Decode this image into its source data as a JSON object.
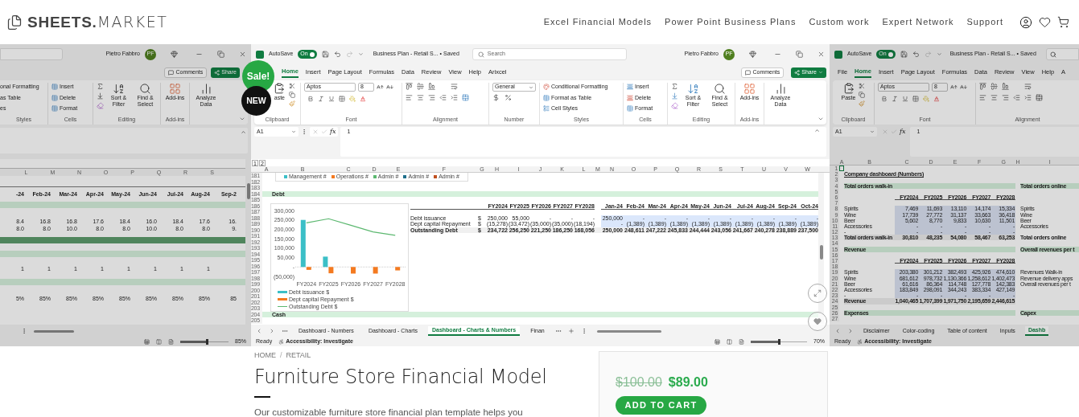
{
  "header": {
    "logo_bold": "SHEETS.",
    "logo_light": "MARKET",
    "nav": [
      "Excel Financial Models",
      "Power Point Business Plans",
      "Custom work",
      "Expert Network",
      "Support"
    ]
  },
  "gallery": {
    "badges": {
      "sale": "Sale!",
      "new": "NEW"
    },
    "left_slide": {
      "user": "Pietro Fabbro",
      "initials": "PF",
      "comments": "Comments",
      "share": "Share",
      "styles": [
        "onal Formatting",
        "as Table",
        "es"
      ],
      "cells": [
        "Insert",
        "Delete",
        "Format"
      ],
      "sort": "Sort & Filter",
      "find": "Find & Select",
      "addins": "Add-ins",
      "analyze": "Analyze Data",
      "groups": [
        "Styles",
        "Cells",
        "Editing",
        "Add-ins"
      ],
      "columns": [
        "L",
        "M",
        "N",
        "O",
        "P",
        "Q",
        "R",
        "S"
      ],
      "months": [
        "-24",
        "Feb-24",
        "Mar-24",
        "Apr-24",
        "May-24",
        "Jun-24",
        "Jul-24",
        "Aug-24",
        "Sep-2"
      ],
      "value_rows": [
        [
          "8.4",
          "16.8",
          "16.8",
          "17.6",
          "18.4",
          "16.0",
          "18.4",
          "17.6",
          "16."
        ],
        [
          "8.0",
          "8.0",
          "10.0",
          "8.0",
          "8.0",
          "10.0",
          "8.0",
          "8.0",
          "9."
        ]
      ],
      "ones": [
        "1",
        "1",
        "1",
        "1",
        "1",
        "1",
        "1",
        "1"
      ],
      "percents": [
        "5%",
        "85%",
        "85%",
        "85%",
        "85%",
        "85%",
        "85%",
        "85%",
        "85"
      ],
      "zoom": "85%",
      "zoom_slider": {
        "level": 0.55
      }
    },
    "main_slide": {
      "autosave": "AutoSave",
      "autosave_on": true,
      "toggle": "On",
      "file": "Business Plan - Retail S... • Saved",
      "search": "Search",
      "user": "Pietro Fabbro",
      "initials": "PF",
      "ribbon_tabs": [
        {
          "label": "Home",
          "selected": true
        },
        {
          "label": "Insert",
          "selected": false
        },
        {
          "label": "Page Layout",
          "selected": false
        },
        {
          "label": "Formulas",
          "selected": false
        },
        {
          "label": "Data",
          "selected": false
        },
        {
          "label": "Review",
          "selected": false
        },
        {
          "label": "View",
          "selected": false
        },
        {
          "label": "Help",
          "selected": false
        },
        {
          "label": "Arixcel",
          "selected": false
        }
      ],
      "comments": "Comments",
      "share": "Share",
      "paste": "aste",
      "font": "Aptos",
      "size": "8",
      "number_format": "General",
      "styles": [
        "Conditional Formatting",
        "Format as Table",
        "Cell Styles"
      ],
      "cells": [
        "Insert",
        "Delete",
        "Format"
      ],
      "sort": "Sort & Filter",
      "find": "Find & Select",
      "addins": "Add-ins",
      "analyze": "Analyze Data",
      "groups": [
        "Clipboard",
        "Font",
        "Alignment",
        "Number",
        "Styles",
        "Cells",
        "Editing",
        "Add-ins"
      ],
      "formula": {
        "cell": "A1",
        "fx": "fx",
        "value": "1"
      },
      "outline_levels": [
        "1",
        "2"
      ],
      "columns": [
        "A",
        "B",
        "C",
        "D",
        "E",
        "F",
        "G",
        "H",
        "I",
        "J",
        "K",
        "L",
        "M",
        "N",
        "O",
        "P",
        "Q",
        "R",
        "S",
        "T",
        "U",
        "V",
        "W"
      ],
      "row_numbers": [
        "181",
        "182",
        "183",
        "184",
        "185",
        "186",
        "187",
        "188",
        "189",
        "190",
        "191",
        "192",
        "193",
        "194",
        "195",
        "196",
        "197",
        "198",
        "199",
        "200",
        "201",
        "202",
        "203",
        "204",
        "205"
      ],
      "legend": [
        {
          "label": "Management #",
          "color": "#3bbfc7"
        },
        {
          "label": "Operations #",
          "color": "#f47a20"
        },
        {
          "label": "Admin #",
          "color": "#5cb870"
        },
        {
          "label": "Admin #",
          "color": "#1f6f8b"
        },
        {
          "label": "Admin #",
          "color": "#c0501f"
        }
      ],
      "sections": [
        "Debt",
        "Cash"
      ],
      "chart_data": {
        "type": "bar",
        "categories": [
          "FY2024",
          "FY2025",
          "FY2026",
          "FY2027",
          "FY2028"
        ],
        "series": [
          {
            "name": "Debt issuance $",
            "type": "bar",
            "color": "#3bbfc7",
            "values": [
              250000,
              55000,
              0,
              0,
              0
            ]
          },
          {
            "name": "Dept capital Repayment $",
            "type": "bar",
            "color": "#f47a20",
            "values": [
              -15278,
              -33472,
              -35000,
              -35000,
              -18194
            ]
          },
          {
            "name": "Outstanding Debt $",
            "type": "line",
            "color": "#5cb870",
            "values": [
              234722,
              256250,
              221250,
              186250,
              168056
            ]
          }
        ],
        "ylim": [
          -50000,
          300000
        ],
        "yticks": [
          {
            "value": 300000,
            "label": "300,000"
          },
          {
            "value": 250000,
            "label": "250,000"
          },
          {
            "value": 200000,
            "label": "200,000"
          },
          {
            "value": 150000,
            "label": "150,000"
          },
          {
            "value": 100000,
            "label": "100,000"
          },
          {
            "value": 50000,
            "label": "50,000"
          },
          {
            "value": 0,
            "label": "-"
          },
          {
            "value": -50000,
            "label": "(50,000)"
          }
        ]
      },
      "debt_table": {
        "fy_headers": [
          "FY2024",
          "FY2025",
          "FY2026",
          "FY2027",
          "FY2028"
        ],
        "month_headers": [
          "Jan-24",
          "Feb-24",
          "Mar-24",
          "Apr-24",
          "May-24",
          "Jun-24",
          "Jul-24",
          "Aug-24",
          "Sep-24",
          "Oct-24"
        ],
        "rows": [
          {
            "kind": "input",
            "label": "Debt issuance",
            "currency": "$",
            "fy": [
              "250,000",
              "55,000",
              "-",
              "-",
              "-"
            ],
            "months": [
              "250,000",
              "-",
              "-",
              "-",
              "-",
              "-",
              "-",
              "-",
              "-",
              "-"
            ]
          },
          {
            "kind": "input",
            "label": "Dept capital Repayment",
            "currency": "$",
            "fy": [
              "(15,278)",
              "(33,472)",
              "(35,000)",
              "(35,000)",
              "(18,194)"
            ],
            "months": [
              "-",
              "(1,389)",
              "(1,389)",
              "(1,389)",
              "(1,389)",
              "(1,389)",
              "(1,389)",
              "(1,389)",
              "(1,389)",
              "(1,389)"
            ]
          },
          {
            "kind": "total",
            "label": "Outstanding Debt",
            "currency": "$",
            "fy": [
              "234,722",
              "256,250",
              "221,250",
              "186,250",
              "168,056"
            ],
            "months": [
              "250,000",
              "248,611",
              "247,222",
              "245,833",
              "244,444",
              "243,056",
              "241,667",
              "240,278",
              "238,889",
              "237,500"
            ]
          }
        ]
      },
      "sheet_tabs": [
        {
          "label": "Dashboard - Numbers",
          "selected": false
        },
        {
          "label": "Dashboard - Charts",
          "selected": false
        },
        {
          "label": "Dashboard - Charts & Numbers",
          "selected": true
        },
        {
          "label": "Finan",
          "selected": false
        }
      ],
      "status": {
        "ready": "Ready",
        "accessibility": "Accessibility: Investigate",
        "zoom": "70%",
        "zoom_slider": {
          "level": 0.5
        }
      }
    },
    "right_slide": {
      "autosave": "AutoSave",
      "autosave_on": true,
      "toggle": "On",
      "file": "Business Plan - Retail S... • Saved",
      "ribbon_tabs": [
        {
          "label": "File",
          "selected": false
        },
        {
          "label": "Home",
          "selected": true
        },
        {
          "label": "Insert",
          "selected": false
        },
        {
          "label": "Page Layout",
          "selected": false
        },
        {
          "label": "Formulas",
          "selected": false
        },
        {
          "label": "Data",
          "selected": false
        },
        {
          "label": "Review",
          "selected": false
        },
        {
          "label": "View",
          "selected": false
        },
        {
          "label": "Help",
          "selected": false
        },
        {
          "label": "A",
          "selected": false
        }
      ],
      "paste": "Paste",
      "font": "Aptos",
      "size": "8",
      "groups": [
        "Clipboard",
        "Font",
        "Alignment"
      ],
      "formula": {
        "cell": "A1",
        "fx": "fx",
        "value": "1"
      },
      "columns": [
        "A",
        "B",
        "C",
        "D",
        "E",
        "F",
        "G",
        "H",
        "I"
      ],
      "rows": [
        {
          "n": "1",
          "kind": "blank"
        },
        {
          "n": "2",
          "kind": "title",
          "label": "Company dashboard (Numbers)"
        },
        {
          "n": "3",
          "kind": "blank"
        },
        {
          "n": "4",
          "kind": "section",
          "label": "Total orders walk-in",
          "right": "Total orders online"
        },
        {
          "n": "5",
          "kind": "blank"
        },
        {
          "n": "6",
          "kind": "header",
          "values": [
            "FY2024",
            "FY2025",
            "FY2026",
            "FY2027",
            "FY2028"
          ]
        },
        {
          "n": "7",
          "kind": "blank"
        },
        {
          "n": "8",
          "kind": "row",
          "label": "Spirits",
          "values": [
            "7,469",
            "11,693",
            "13,110",
            "14,174",
            "15,334"
          ],
          "right": "Spirits"
        },
        {
          "n": "9",
          "kind": "row",
          "label": "Wine",
          "values": [
            "17,739",
            "27,772",
            "31,137",
            "33,663",
            "36,418"
          ],
          "right": "Wine"
        },
        {
          "n": "10",
          "kind": "row",
          "label": "Beer",
          "values": [
            "5,602",
            "8,770",
            "9,833",
            "10,630",
            "11,501"
          ],
          "right": "Beer"
        },
        {
          "n": "11",
          "kind": "row",
          "label": "Accessories",
          "values": [
            "-",
            "-",
            "-",
            "-",
            "-"
          ],
          "right": "Accessories"
        },
        {
          "n": "12",
          "kind": "row",
          "label": "-",
          "values": [
            "-",
            "-",
            "-",
            "-",
            "-"
          ]
        },
        {
          "n": "13",
          "kind": "total",
          "label": "Total orders walk-in",
          "values": [
            "30,810",
            "48,235",
            "54,080",
            "58,467",
            "63,253"
          ],
          "right": "Total orders online"
        },
        {
          "n": "14",
          "kind": "blank"
        },
        {
          "n": "15",
          "kind": "section",
          "label": "Revenue",
          "right": "Overall revenues per t"
        },
        {
          "n": "16",
          "kind": "blank"
        },
        {
          "n": "17",
          "kind": "header",
          "values": [
            "FY2024",
            "FY2025",
            "FY2026",
            "FY2027",
            "FY2028"
          ]
        },
        {
          "n": "18",
          "kind": "blank"
        },
        {
          "n": "19",
          "kind": "row",
          "label": "Spirits",
          "values": [
            "203,380",
            "301,212",
            "382,493",
            "425,926",
            "474,610"
          ],
          "right": "Revenues Walk-in"
        },
        {
          "n": "20",
          "kind": "row",
          "label": "Wine",
          "values": [
            "681,612",
            "978,732",
            "1,130,366",
            "1,258,612",
            "1,402,473"
          ],
          "right": "Revenue delivery apps"
        },
        {
          "n": "21",
          "kind": "row",
          "label": "Beer",
          "values": [
            "61,616",
            "86,364",
            "114,748",
            "127,778",
            "142,383"
          ],
          "right": "Overall revenues per t"
        },
        {
          "n": "22",
          "kind": "row",
          "label": "Accessories",
          "values": [
            "183,849",
            "298,091",
            "344,243",
            "383,334",
            "427,149"
          ]
        },
        {
          "n": "23",
          "kind": "row",
          "label": "-",
          "values": [
            "-",
            "-",
            "-",
            "-",
            "-"
          ]
        },
        {
          "n": "24",
          "kind": "total",
          "label": "Revenue",
          "values": [
            "1,040,465",
            "1,707,399",
            "1,971,750",
            "2,195,659",
            "2,446,615"
          ]
        },
        {
          "n": "25",
          "kind": "blank"
        },
        {
          "n": "26",
          "kind": "section",
          "label": "Expenses",
          "right": "Capex"
        },
        {
          "n": "27",
          "kind": "blank"
        }
      ],
      "sheet_tabs": [
        {
          "label": "Disclaimer",
          "selected": false
        },
        {
          "label": "Color-coding",
          "selected": false
        },
        {
          "label": "Table of content",
          "selected": false
        },
        {
          "label": "Inputs",
          "selected": false
        },
        {
          "label": "Dashb",
          "selected": true
        }
      ],
      "status": {
        "ready": "Ready",
        "accessibility": "Accessibility: Investigate"
      }
    }
  },
  "breadcrumb": {
    "items": [
      "HOME",
      "RETAIL"
    ],
    "separator": "/"
  },
  "title": "Furniture Store Financial Model",
  "description": "Our customizable furniture store financial plan template helps you",
  "price": {
    "old": "$100.00",
    "new": "$89.00"
  },
  "add_to_cart": "ADD TO CART"
}
